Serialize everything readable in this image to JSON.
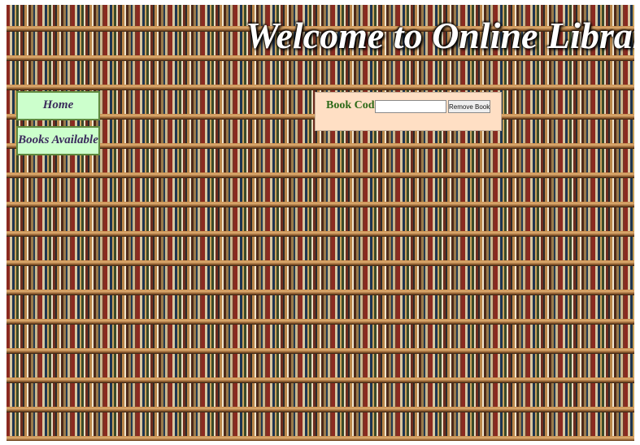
{
  "header": {
    "title": "Welcome to Online Library"
  },
  "nav": {
    "items": [
      {
        "label": "Home"
      },
      {
        "label": "Books Available"
      }
    ]
  },
  "remove_form": {
    "label": "Book Code:",
    "input_value": "",
    "button_label": "Remove Book"
  },
  "colors": {
    "nav_background": "#ccffcc",
    "nav_text": "#3a2a5c",
    "panel_background": "#ffdfc4",
    "label_text": "#2e6b1a"
  }
}
